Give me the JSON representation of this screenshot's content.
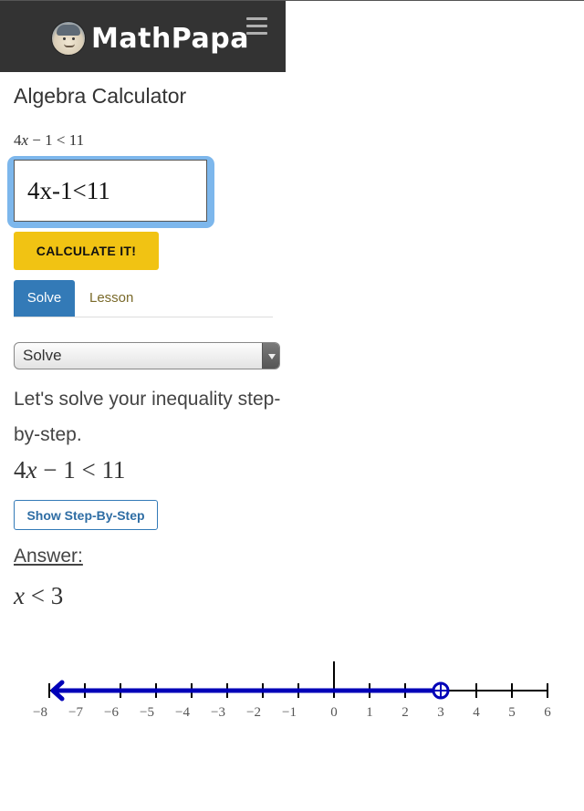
{
  "header": {
    "brand": "MathPapa",
    "logo_icon": "mathpapa-face-logo",
    "menu_icon": "hamburger-menu-icon"
  },
  "page": {
    "title": "Algebra Calculator",
    "math_preview": {
      "coef": "4",
      "var": "x",
      "rest": " − 1 < 11"
    }
  },
  "input": {
    "value": "4x-1<11",
    "placeholder": ""
  },
  "buttons": {
    "calculate": "CALCULATE IT!",
    "show_steps": "Show Step-By-Step"
  },
  "tabs": [
    {
      "label": "Solve",
      "active": true
    },
    {
      "label": "Lesson",
      "active": false
    }
  ],
  "mode_select": {
    "selected": "Solve"
  },
  "solution": {
    "intro": "Let's solve your inequality step-by-step.",
    "equation": {
      "coef": "4",
      "var": "x",
      "rest": " − 1 < 11"
    },
    "answer_label": "Answer:",
    "answer": {
      "var": "x",
      "rest": " < 3"
    }
  },
  "number_line": {
    "min": -8,
    "max": 6,
    "ticks": [
      "−8",
      "−7",
      "−6",
      "−5",
      "−4",
      "−3",
      "−2",
      "−1",
      "0",
      "1",
      "2",
      "3",
      "4",
      "5",
      "6"
    ],
    "boundary": 3,
    "boundary_type": "open",
    "direction": "left",
    "shade_color": "#0000b8",
    "axis_color": "#000000"
  },
  "colors": {
    "navbar": "#333333",
    "calculate_button": "#f1c313",
    "tab_active": "#337ab7",
    "input_focus_glow": "#7db7ec",
    "lesson_tab_text": "#7a6a2a"
  }
}
